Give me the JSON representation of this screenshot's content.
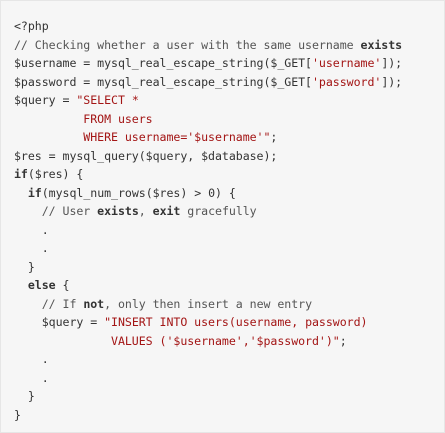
{
  "code": {
    "lines": [
      [
        {
          "t": "<?php",
          "c": "plain"
        }
      ],
      [
        {
          "t": "// Checking whether a user with the same username ",
          "c": "cm"
        },
        {
          "t": "exists",
          "c": "kw"
        }
      ],
      [
        {
          "t": "$username = mysql_real_escape_string($_GET[",
          "c": "plain"
        },
        {
          "t": "'username'",
          "c": "str"
        },
        {
          "t": "]);",
          "c": "plain"
        }
      ],
      [
        {
          "t": "$password = mysql_real_escape_string($_GET[",
          "c": "plain"
        },
        {
          "t": "'password'",
          "c": "str"
        },
        {
          "t": "]);",
          "c": "plain"
        }
      ],
      [
        {
          "t": "$query = ",
          "c": "plain"
        },
        {
          "t": "\"SELECT *",
          "c": "str"
        }
      ],
      [
        {
          "t": "          FROM users",
          "c": "str"
        }
      ],
      [
        {
          "t": "          WHERE username='$username'\"",
          "c": "str"
        },
        {
          "t": ";",
          "c": "plain"
        }
      ],
      [
        {
          "t": "$res = mysql_query($query, $database);",
          "c": "plain"
        }
      ],
      [
        {
          "t": "if",
          "c": "kw"
        },
        {
          "t": "($res) {",
          "c": "plain"
        }
      ],
      [
        {
          "t": "  ",
          "c": "plain"
        },
        {
          "t": "if",
          "c": "kw"
        },
        {
          "t": "(mysql_num_rows($res) > 0) {",
          "c": "plain"
        }
      ],
      [
        {
          "t": "    // User ",
          "c": "cm"
        },
        {
          "t": "exists",
          "c": "kw"
        },
        {
          "t": ", ",
          "c": "cm"
        },
        {
          "t": "exit",
          "c": "kw"
        },
        {
          "t": " gracefully",
          "c": "cm"
        }
      ],
      [
        {
          "t": "    .",
          "c": "plain"
        }
      ],
      [
        {
          "t": "    .",
          "c": "plain"
        }
      ],
      [
        {
          "t": "  }",
          "c": "plain"
        }
      ],
      [
        {
          "t": "  ",
          "c": "plain"
        },
        {
          "t": "else",
          "c": "kw"
        },
        {
          "t": " {",
          "c": "plain"
        }
      ],
      [
        {
          "t": "    // If ",
          "c": "cm"
        },
        {
          "t": "not",
          "c": "kw"
        },
        {
          "t": ", only then insert a new entry",
          "c": "cm"
        }
      ],
      [
        {
          "t": "    $query = ",
          "c": "plain"
        },
        {
          "t": "\"INSERT INTO users(username, password)",
          "c": "str"
        }
      ],
      [
        {
          "t": "              VALUES ('$username','$password')\"",
          "c": "str"
        },
        {
          "t": ";",
          "c": "plain"
        }
      ],
      [
        {
          "t": "    .",
          "c": "plain"
        }
      ],
      [
        {
          "t": "    .",
          "c": "plain"
        }
      ],
      [
        {
          "t": "  }",
          "c": "plain"
        }
      ],
      [
        {
          "t": "}",
          "c": "plain"
        }
      ]
    ]
  }
}
